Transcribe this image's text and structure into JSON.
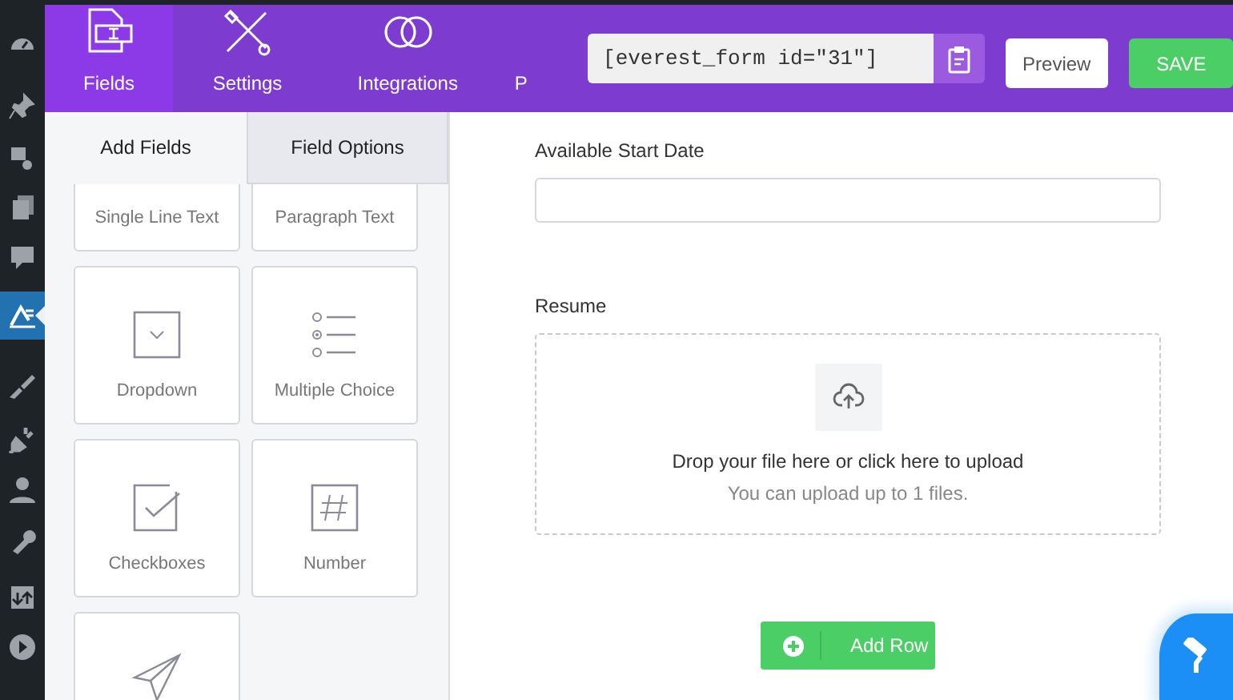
{
  "admin_menu": {
    "items": [
      {
        "selected": false
      },
      {
        "selected": false
      },
      {
        "selected": false
      },
      {
        "selected": false
      },
      {
        "selected": false
      },
      {
        "selected": true
      },
      {
        "selected": false
      },
      {
        "selected": false
      },
      {
        "selected": false
      },
      {
        "selected": false
      },
      {
        "selected": false
      },
      {
        "selected": false
      }
    ]
  },
  "header": {
    "tabs": [
      {
        "label": "Fields",
        "selected": true
      },
      {
        "label": "Settings",
        "selected": false
      },
      {
        "label": "Integrations",
        "selected": false
      },
      {
        "label": "P",
        "selected": false
      }
    ],
    "shortcode": {
      "value": "[everest_form id=\"31\"]"
    },
    "preview_button": "Preview",
    "save_button": "SAVE"
  },
  "panel": {
    "tabs": [
      {
        "label": "Add Fields",
        "selected": true
      },
      {
        "label": "Field Options",
        "selected": false
      }
    ],
    "fields": [
      {
        "kind": "text",
        "label": "Single Line Text"
      },
      {
        "kind": "paragraph",
        "label": "Paragraph Text"
      },
      {
        "kind": "dropdown",
        "label": "Dropdown"
      },
      {
        "kind": "radio",
        "label": "Multiple Choice"
      },
      {
        "kind": "checkbox",
        "label": "Checkboxes"
      },
      {
        "kind": "number",
        "label": "Number"
      },
      {
        "kind": "submit"
      }
    ]
  },
  "form": {
    "fields": [
      {
        "kind": "date",
        "label": "Available Start Date"
      },
      {
        "kind": "file",
        "label": "Resume",
        "drop_text": "Drop your file here or click here to upload",
        "hint": "You can upload up to 1 files."
      }
    ],
    "add_row_button": "Add Row"
  }
}
